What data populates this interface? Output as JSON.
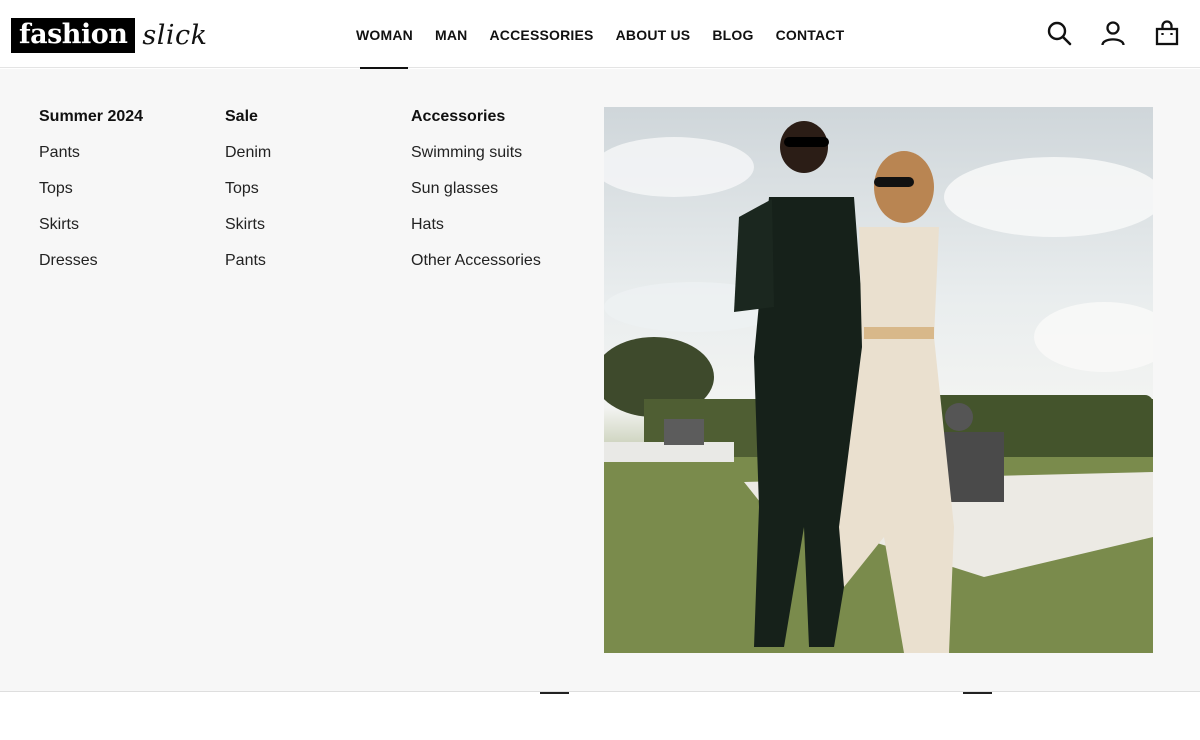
{
  "brand": {
    "logo_box": "fashion",
    "logo_script": "slick"
  },
  "nav": {
    "items": [
      {
        "label": "WOMAN",
        "active": true
      },
      {
        "label": "MAN"
      },
      {
        "label": "ACCESSORIES"
      },
      {
        "label": "ABOUT US"
      },
      {
        "label": "BLOG"
      },
      {
        "label": "CONTACT"
      }
    ]
  },
  "header_icons": [
    "search-icon",
    "user-icon",
    "shopping-bag-icon"
  ],
  "mega_menu": {
    "columns": [
      {
        "title": "Summer 2024",
        "links": [
          "Pants",
          "Tops",
          "Skirts",
          "Dresses"
        ]
      },
      {
        "title": "Sale",
        "links": [
          "Denim",
          "Tops",
          "Skirts",
          "Pants"
        ]
      },
      {
        "title": "Accessories",
        "links": [
          "Swimming suits",
          "Sun glasses",
          "Hats",
          "Other Accessories"
        ]
      }
    ]
  },
  "colors": {
    "accent": "#111111",
    "menu_bg": "#f7f7f7",
    "header_bg": "#ffffff"
  }
}
